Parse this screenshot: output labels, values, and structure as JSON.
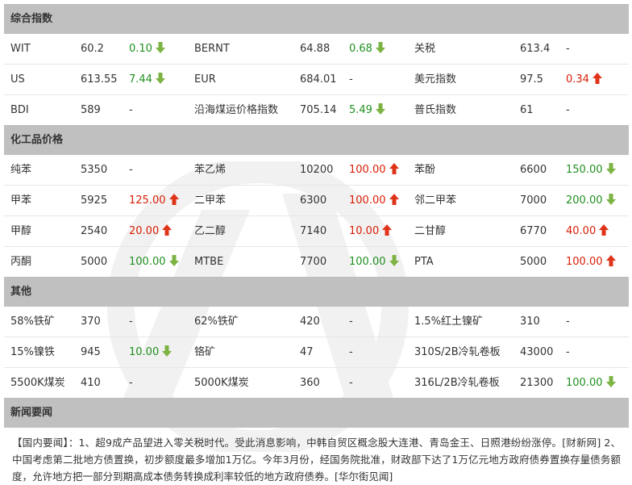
{
  "sections": [
    {
      "title": "综合指数",
      "rows": [
        [
          {
            "name": "WIT",
            "value": "60.2",
            "change": "0.10",
            "dir": "down"
          },
          {
            "name": "BERNT",
            "value": "64.88",
            "change": "0.68",
            "dir": "down"
          },
          {
            "name": "关税",
            "value": "613.4",
            "change": "-",
            "dir": "flat"
          }
        ],
        [
          {
            "name": "US",
            "value": "613.55",
            "change": "7.44",
            "dir": "down"
          },
          {
            "name": "EUR",
            "value": "684.01",
            "change": "-",
            "dir": "flat"
          },
          {
            "name": "美元指数",
            "value": "97.5",
            "change": "0.34",
            "dir": "up"
          }
        ],
        [
          {
            "name": "BDI",
            "value": "589",
            "change": "-",
            "dir": "flat"
          },
          {
            "name": "沿海煤运价格指数",
            "value": "705.14",
            "change": "5.49",
            "dir": "down"
          },
          {
            "name": "普氏指数",
            "value": "61",
            "change": "-",
            "dir": "flat"
          }
        ]
      ]
    },
    {
      "title": "化工品价格",
      "rows": [
        [
          {
            "name": "纯苯",
            "value": "5350",
            "change": "-",
            "dir": "flat"
          },
          {
            "name": "苯乙烯",
            "value": "10200",
            "change": "100.00",
            "dir": "up"
          },
          {
            "name": "苯酚",
            "value": "6600",
            "change": "150.00",
            "dir": "down"
          }
        ],
        [
          {
            "name": "甲苯",
            "value": "5925",
            "change": "125.00",
            "dir": "up"
          },
          {
            "name": "二甲苯",
            "value": "6300",
            "change": "100.00",
            "dir": "up"
          },
          {
            "name": "邻二甲苯",
            "value": "7000",
            "change": "200.00",
            "dir": "down"
          }
        ],
        [
          {
            "name": "甲醇",
            "value": "2540",
            "change": "20.00",
            "dir": "up"
          },
          {
            "name": "乙二醇",
            "value": "7140",
            "change": "10.00",
            "dir": "up"
          },
          {
            "name": "二甘醇",
            "value": "6770",
            "change": "40.00",
            "dir": "up"
          }
        ],
        [
          {
            "name": "丙酮",
            "value": "5000",
            "change": "100.00",
            "dir": "down"
          },
          {
            "name": "MTBE",
            "value": "7700",
            "change": "100.00",
            "dir": "down"
          },
          {
            "name": "PTA",
            "value": "5000",
            "change": "100.00",
            "dir": "up"
          }
        ]
      ]
    },
    {
      "title": "其他",
      "rows": [
        [
          {
            "name": "58%铁矿",
            "value": "370",
            "change": "-",
            "dir": "flat"
          },
          {
            "name": "62%铁矿",
            "value": "420",
            "change": "-",
            "dir": "flat"
          },
          {
            "name": "1.5%红土镍矿",
            "value": "310",
            "change": "-",
            "dir": "flat"
          }
        ],
        [
          {
            "name": "15%镍铁",
            "value": "945",
            "change": "10.00",
            "dir": "down"
          },
          {
            "name": "铬矿",
            "value": "47",
            "change": "-",
            "dir": "flat"
          },
          {
            "name": "310S/2B冷轧卷板",
            "value": "43000",
            "change": "-",
            "dir": "flat"
          }
        ],
        [
          {
            "name": "5500K煤炭",
            "value": "410",
            "change": "-",
            "dir": "flat"
          },
          {
            "name": "5000K煤炭",
            "value": "360",
            "change": "-",
            "dir": "flat"
          },
          {
            "name": "316L/2B冷轧卷板",
            "value": "21300",
            "change": "100.00",
            "dir": "down"
          }
        ]
      ]
    }
  ],
  "news": {
    "title": "新闻要闻",
    "body": "【国内要闻】：1、超9成产品望进入零关税时代。受此消息影响，中韩自贸区概念股大连港、青岛金王、日照港纷纷涨停。[财新网] 2、中国考虑第二批地方债置换，初步额度最多增加1万亿。今年3月份，经国务院批准，财政部下达了1万亿元地方政府债券置换存量债务额度，允许地方把一部分到期高成本债务转换成利率较低的地方政府债券。[华尔街见闻]"
  },
  "colors": {
    "header_bg": "#c0c0c0",
    "up": "#d81e06",
    "down": "#1f8f1f",
    "arrow_up": "#e0341a",
    "arrow_down": "#7cb342"
  },
  "icons": {
    "up": "arrow-up-icon",
    "down": "arrow-down-icon"
  }
}
